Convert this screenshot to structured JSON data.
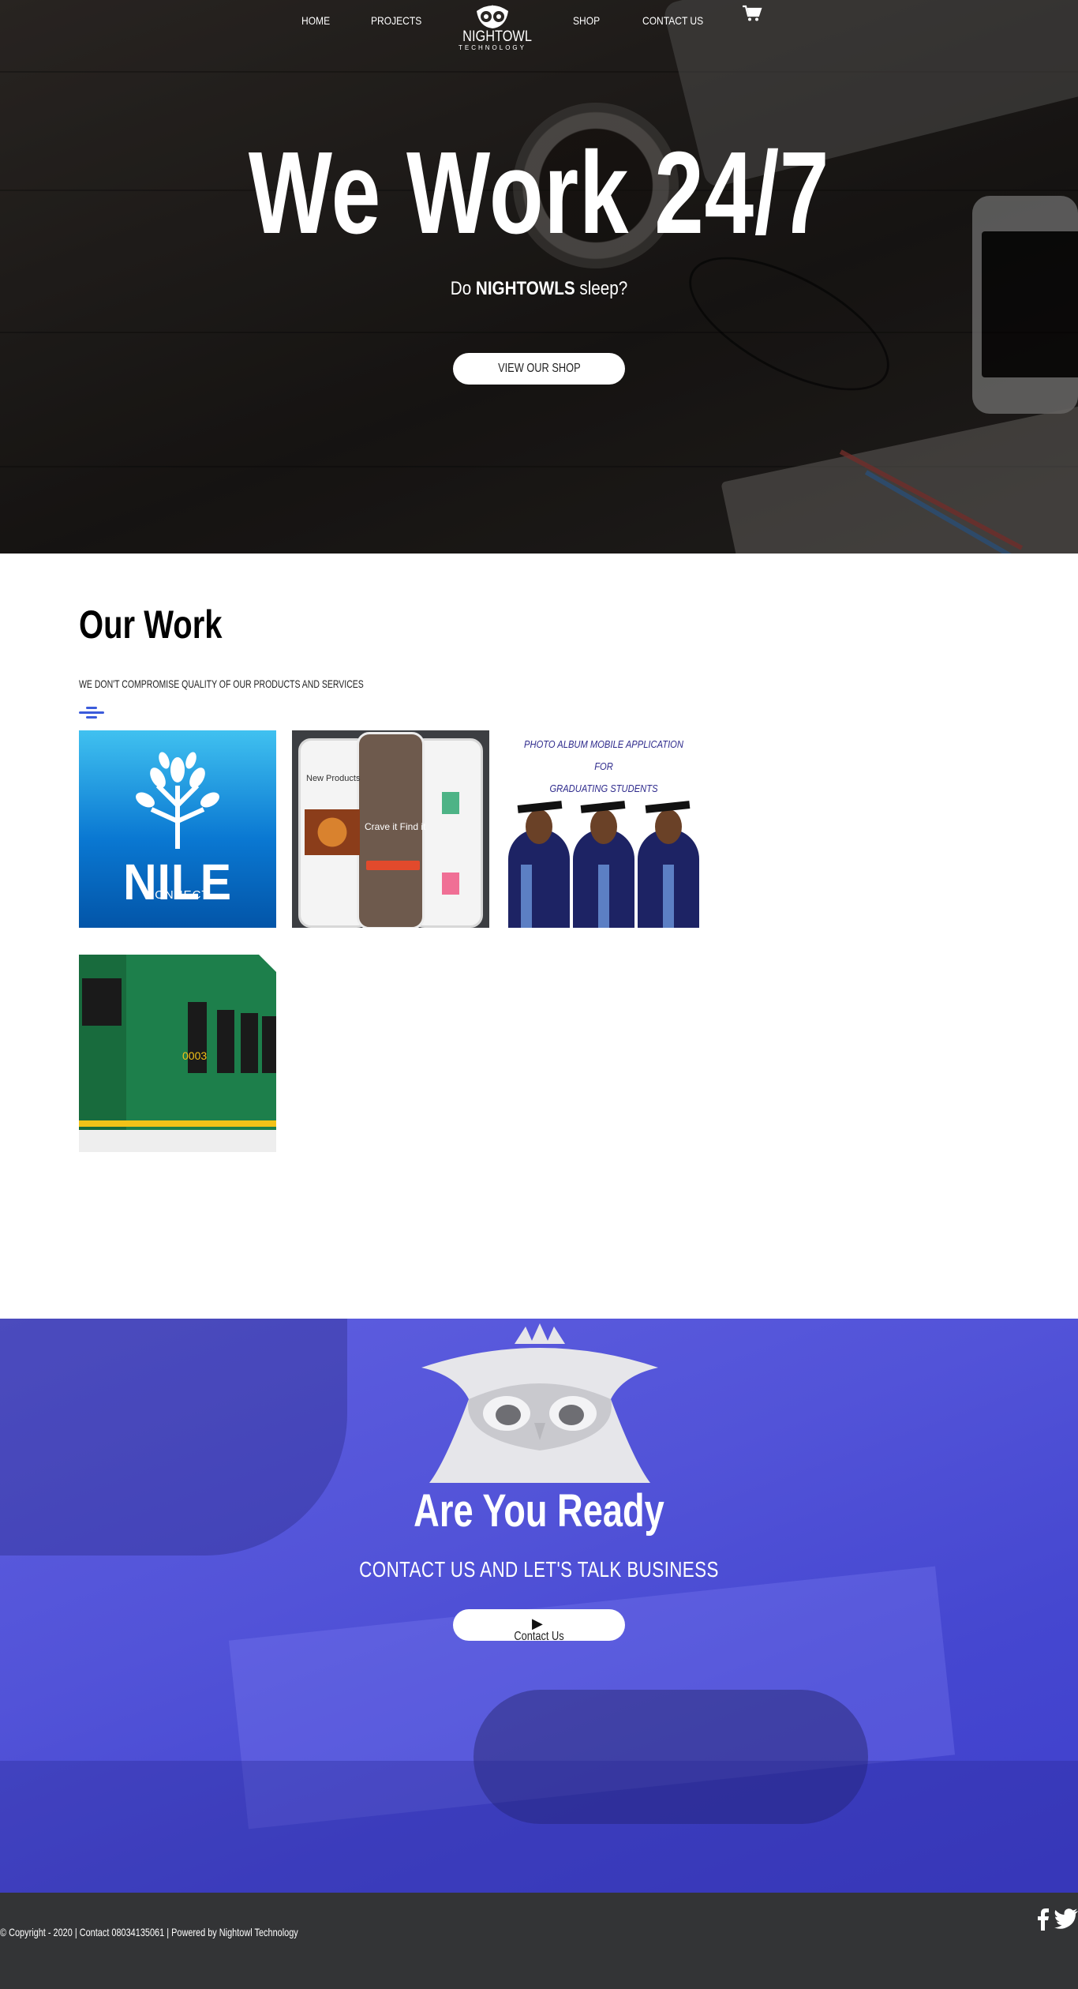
{
  "nav": {
    "items": [
      "HOME",
      "PROJECTS",
      "SHOP",
      "CONTACT US"
    ],
    "logo_name": "NIGHTOWL",
    "logo_sub": "TECHNOLOGY",
    "cart_icon": "cart-icon"
  },
  "hero": {
    "title": "We Work 24/7",
    "sub_prefix": "Do ",
    "sub_bold": "NIGHTOWLS",
    "sub_suffix": " sleep?",
    "button": "VIEW OUR SHOP"
  },
  "work": {
    "title": "Our Work",
    "subtitle": "WE DON'T COMPROMISE QUALITY OF OUR PRODUCTS AND SERVICES",
    "filter_icon": "filter-icon",
    "tiles": [
      {
        "name": "NILE",
        "sub": "CONNECT"
      },
      {
        "name": "New Products",
        "sub": "Crave it Find it"
      },
      {
        "line1": "PHOTO ALBUM MOBILE APPLICATION",
        "line2": "FOR",
        "line3": "GRADUATING STUDENTS"
      },
      {
        "number": "0003"
      }
    ]
  },
  "ready": {
    "title": "Are You Ready",
    "subtitle": "CONTACT US AND LET'S TALK BUSINESS",
    "button_icon": "▶",
    "button": "Contact Us"
  },
  "footer": {
    "copyright": "© Copyright - 2020 | Contact 08034135061 | Powered by Nightowl Technology",
    "social": [
      "facebook-icon",
      "twitter-icon"
    ]
  },
  "colors": {
    "accent_blue": "#3b5bdb",
    "ready_bg": "#5253d8",
    "footer_bg": "#333436"
  }
}
